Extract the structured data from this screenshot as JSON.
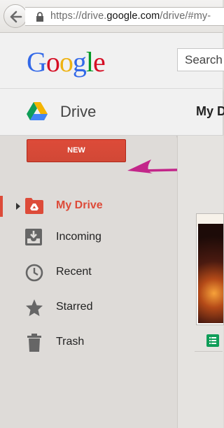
{
  "browser": {
    "url_prefix": "https://drive.",
    "url_domain": "google.com",
    "url_suffix": "/drive/#my-"
  },
  "header": {
    "logo_letters": [
      {
        "char": "G",
        "color": "#3369e8"
      },
      {
        "char": "o",
        "color": "#d50f25"
      },
      {
        "char": "o",
        "color": "#eeb211"
      },
      {
        "char": "g",
        "color": "#3369e8"
      },
      {
        "char": "l",
        "color": "#009925"
      },
      {
        "char": "e",
        "color": "#d50f25"
      }
    ],
    "search_placeholder": "Search"
  },
  "drive_bar": {
    "app_title": "Drive",
    "section_title": "My D"
  },
  "sidebar": {
    "new_button_label": "NEW",
    "items": [
      {
        "label": "My Drive",
        "icon": "my-drive-icon",
        "active": true
      },
      {
        "label": "Incoming",
        "icon": "incoming-icon",
        "active": false
      },
      {
        "label": "Recent",
        "icon": "clock-icon",
        "active": false
      },
      {
        "label": "Starred",
        "icon": "star-icon",
        "active": false
      },
      {
        "label": "Trash",
        "icon": "trash-icon",
        "active": false
      }
    ]
  },
  "colors": {
    "accent_red": "#dd4b39",
    "annotation_arrow": "#c3268a",
    "icon_gray": "#666666",
    "sheets_green": "#0f9d58"
  }
}
